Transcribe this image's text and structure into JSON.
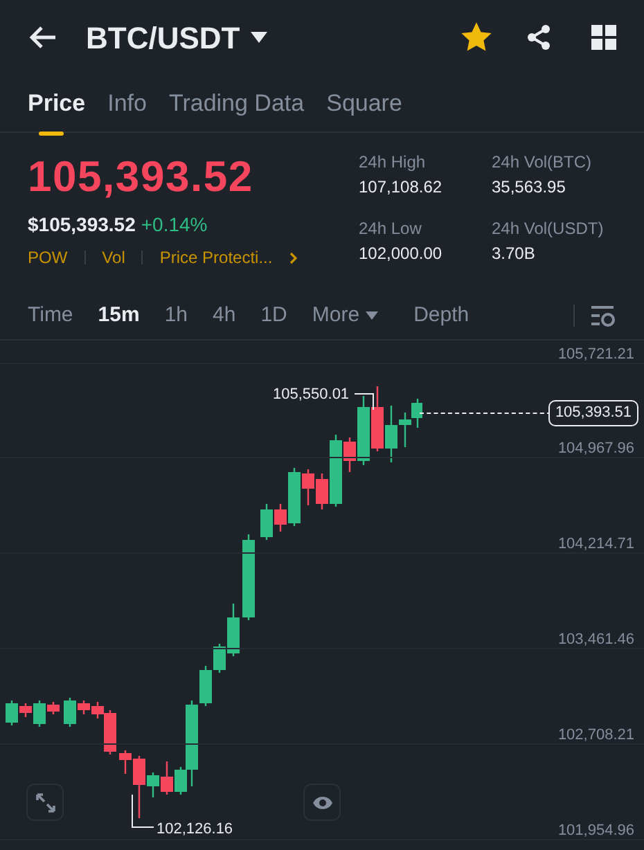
{
  "header": {
    "title": "BTC/USDT",
    "favorite": true
  },
  "tabs": [
    {
      "label": "Price",
      "selected": true
    },
    {
      "label": "Info",
      "selected": false
    },
    {
      "label": "Trading Data",
      "selected": false
    },
    {
      "label": "Square",
      "selected": false
    }
  ],
  "price": {
    "last": "105,393.52",
    "fiat": "$105,393.52",
    "change": "+0.14%",
    "tags": [
      "POW",
      "Vol",
      "Price Protecti..."
    ]
  },
  "stats": [
    {
      "label": "24h High",
      "value": "107,108.62"
    },
    {
      "label": "24h Vol(BTC)",
      "value": "35,563.95"
    },
    {
      "label": "24h Low",
      "value": "102,000.00"
    },
    {
      "label": "24h Vol(USDT)",
      "value": "3.70B"
    }
  ],
  "timeframes": [
    {
      "label": "Time",
      "kind": "option",
      "selected": false
    },
    {
      "label": "15m",
      "kind": "option",
      "selected": true
    },
    {
      "label": "1h",
      "kind": "option",
      "selected": false
    },
    {
      "label": "4h",
      "kind": "option",
      "selected": false
    },
    {
      "label": "1D",
      "kind": "option",
      "selected": false
    },
    {
      "label": "More",
      "kind": "menu",
      "selected": false
    },
    {
      "label": "Depth",
      "kind": "option",
      "selected": false
    }
  ],
  "chart": {
    "price_axis": [
      "105,721.21",
      "104,967.96",
      "104,214.71",
      "103,461.46",
      "102,708.21",
      "101,954.96"
    ],
    "current_price": "105,393.51",
    "high_label": "105,550.01",
    "low_label": "102,126.16"
  }
}
